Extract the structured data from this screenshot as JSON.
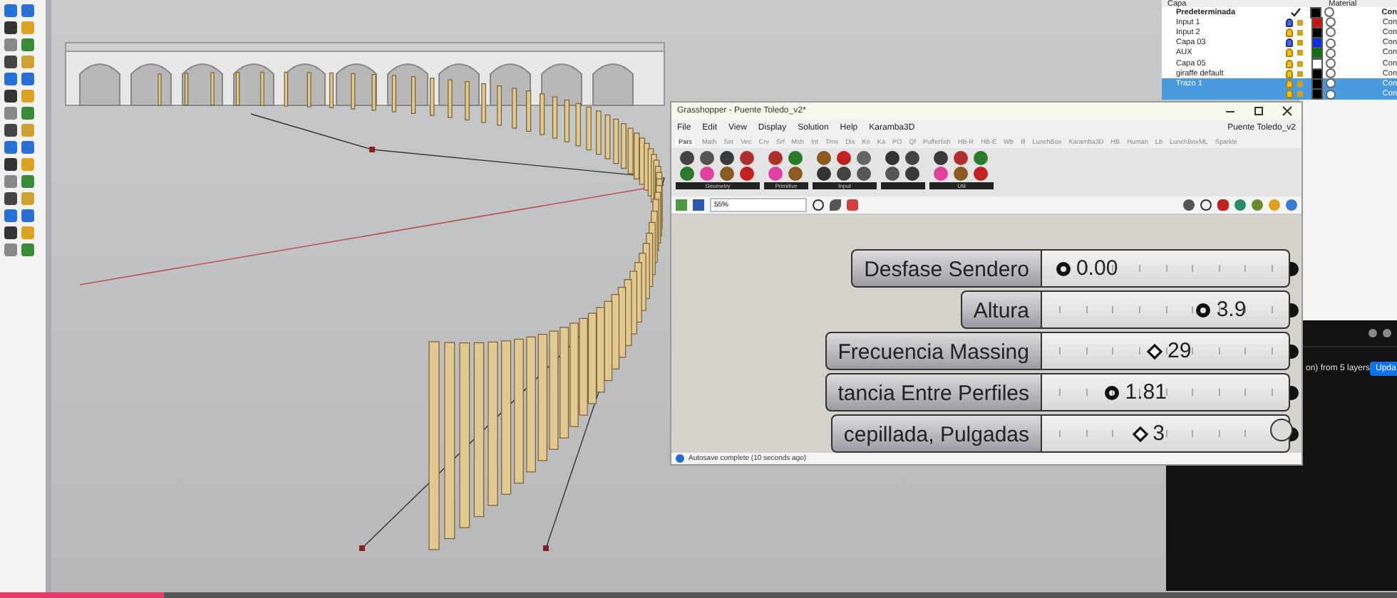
{
  "layers_panel": {
    "columns": [
      "Capa",
      "Material"
    ],
    "layers": [
      {
        "name": "Predeterminada",
        "current": true,
        "color": "#000000",
        "selected": false,
        "linetype": "Con"
      },
      {
        "name": "Input 1",
        "current": false,
        "visible": false,
        "color": "#d01010",
        "selected": false,
        "linetype": "Con"
      },
      {
        "name": "Input 2",
        "current": false,
        "visible": true,
        "color": "#000000",
        "selected": false,
        "linetype": "Con"
      },
      {
        "name": "Capa 03",
        "current": false,
        "visible": false,
        "color": "#1030e0",
        "selected": false,
        "linetype": "Con"
      },
      {
        "name": "AUX",
        "current": false,
        "visible": true,
        "color": "#107010",
        "selected": false,
        "linetype": "Con"
      },
      {
        "name": "Capa 05",
        "current": false,
        "visible": true,
        "color": "#ffffff",
        "selected": false,
        "linetype": "Con"
      },
      {
        "name": "giraffe default",
        "current": false,
        "visible": true,
        "color": "#000000",
        "selected": false,
        "linetype": "Con"
      },
      {
        "name": "Trazo 1",
        "current": false,
        "visible": true,
        "color": "#000000",
        "selected": true,
        "linetype": "Con"
      },
      {
        "current": false,
        "visible": true,
        "color": "#000000",
        "selected": true,
        "linetype": "Con"
      }
    ]
  },
  "grasshopper": {
    "title": "Grasshopper - Puente Toledo_v2*",
    "document": "Puente Toledo_v2",
    "menu": [
      "File",
      "Edit",
      "View",
      "Display",
      "Solution",
      "Help",
      "Karamba3D"
    ],
    "tabs": [
      {
        "label": "Pars",
        "selected": true
      },
      {
        "label": "Math",
        "selected": false
      },
      {
        "label": "Set",
        "selected": false
      },
      {
        "label": "Vec",
        "selected": false
      },
      {
        "label": "Crv",
        "selected": false
      },
      {
        "label": "Srf",
        "selected": false
      },
      {
        "label": "Msh",
        "selected": false
      },
      {
        "label": "Int",
        "selected": false
      },
      {
        "label": "Trns",
        "selected": false
      },
      {
        "label": "Dis",
        "selected": false
      },
      {
        "label": "Kn",
        "selected": false
      },
      {
        "label": "Ka",
        "selected": false
      },
      {
        "label": "PO",
        "selected": false
      },
      {
        "label": "Qf",
        "selected": false
      },
      {
        "label": "Pufferfish",
        "selected": false
      },
      {
        "label": "HB-R",
        "selected": false
      },
      {
        "label": "HB-E",
        "selected": false
      },
      {
        "label": "Wb",
        "selected": false
      },
      {
        "label": "Ill",
        "selected": false
      },
      {
        "label": "LunchBox",
        "selected": false
      },
      {
        "label": "Karamba3D",
        "selected": false
      },
      {
        "label": "HB",
        "selected": false
      },
      {
        "label": "Human",
        "selected": false
      },
      {
        "label": "Lb",
        "selected": false
      },
      {
        "label": "LunchBoxML",
        "selected": false
      },
      {
        "label": "Sparkle",
        "selected": false
      }
    ],
    "ribbon_groups": [
      "Geometry",
      "Primitive",
      "Input",
      "Util"
    ],
    "zoom_field": {
      "value": "55%"
    },
    "sliders": [
      {
        "label": "Desfase Sendero",
        "kind": "round",
        "value": "0.00",
        "level": 0.02
      },
      {
        "label": "Altura",
        "kind": "round",
        "value": "3.9",
        "level": 0.68
      },
      {
        "label": "Frecuencia Massing",
        "kind": "diamond",
        "value": "29",
        "level": 0.45
      },
      {
        "label": "tancia Entre Perfiles",
        "kind": "round",
        "value": "1.81",
        "level": 0.25
      },
      {
        "label": "cepillada, Pulgadas",
        "kind": "diamond",
        "value": "3",
        "level": 0.38
      }
    ],
    "status": "Autosave complete (10 seconds ago)"
  },
  "meeting_panel": {
    "message": "on) from 5 layers",
    "button": "Upda"
  },
  "video_progress": {
    "level": 0.117
  }
}
